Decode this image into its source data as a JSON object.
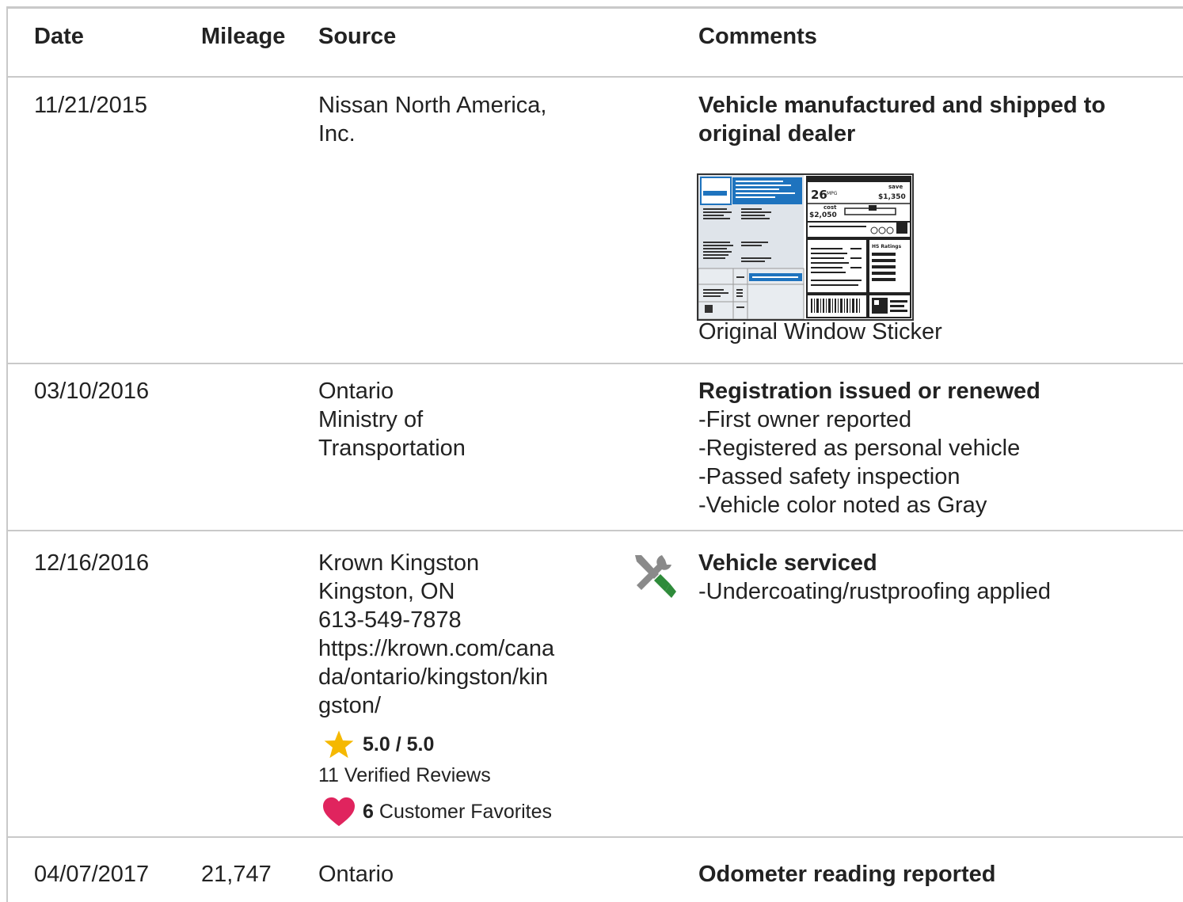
{
  "header": {
    "date": "Date",
    "mileage": "Mileage",
    "source": "Source",
    "comments": "Comments"
  },
  "rows": [
    {
      "date": "11/21/2015",
      "mileage": "",
      "source_lines": [
        "Nissan North America,",
        "Inc."
      ],
      "comment_title_lines": [
        "Vehicle manufactured and shipped to",
        "original dealer"
      ],
      "sticker": {
        "caption": "Original Window Sticker",
        "mpg": "26",
        "mpg_unit": "MPG",
        "save_label": "save",
        "save_value": "$1,350",
        "cost_label": "cost",
        "cost_value": "$2,050",
        "ratings_label": "HS Ratings"
      }
    },
    {
      "date": "03/10/2016",
      "mileage": "",
      "source_lines": [
        "Ontario",
        "Ministry of",
        "Transportation"
      ],
      "comment_title_lines": [
        "Registration issued or renewed"
      ],
      "bullets": [
        "First owner reported",
        "Registered as personal vehicle",
        "Passed safety inspection",
        "Vehicle color noted as Gray"
      ]
    },
    {
      "date": "12/16/2016",
      "mileage": "",
      "source_lines": [
        "Krown Kingston",
        "Kingston, ON",
        "613-549-7878",
        "https://krown.com/cana",
        "da/ontario/kingston/kin",
        "gston/"
      ],
      "rating": "5.0 / 5.0",
      "reviews": "11 Verified Reviews",
      "favorites_count": "6",
      "favorites_label": "Customer Favorites",
      "comment_icon": "wrench-screwdriver-icon",
      "comment_title_lines": [
        "Vehicle serviced"
      ],
      "bullets": [
        "Undercoating/rustproofing applied"
      ]
    },
    {
      "date": "04/07/2017",
      "mileage": "21,747",
      "source_lines": [
        "Ontario"
      ],
      "comment_title_lines": [
        "Odometer reading reported"
      ]
    }
  ],
  "colors": {
    "rule": "#c9c9c9",
    "sticker_blue": "#1e73be",
    "star": "#f5b800",
    "heart": "#e0245e",
    "tool_green": "#2e8b3a",
    "tool_gray": "#8a8a8a"
  }
}
